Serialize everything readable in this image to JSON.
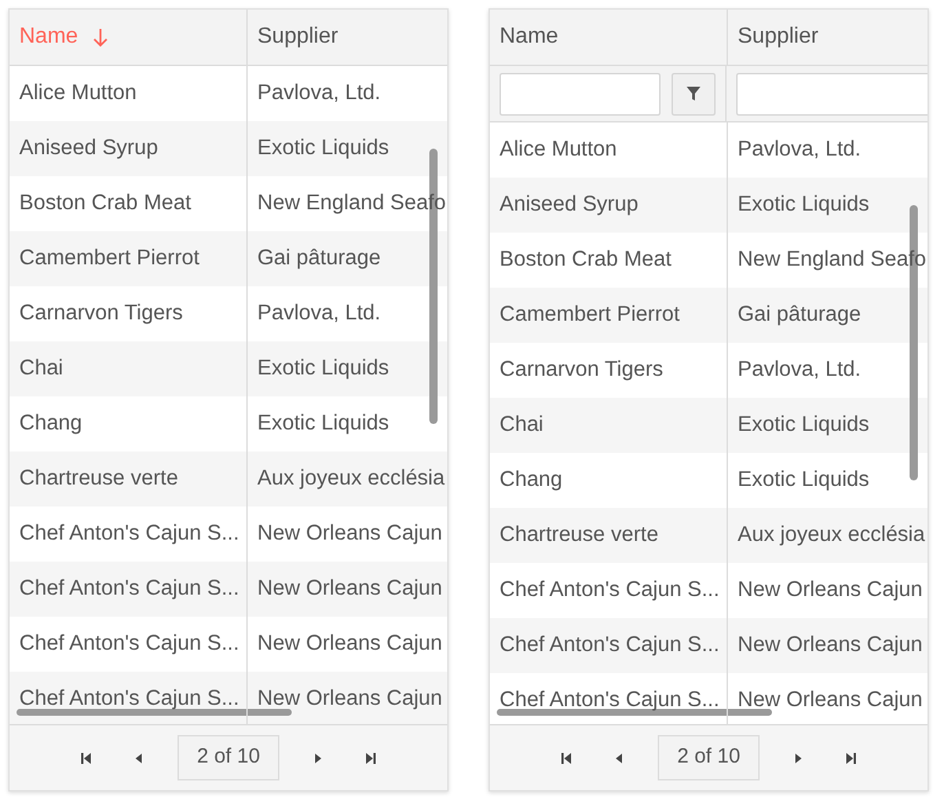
{
  "grids": [
    {
      "columns": [
        {
          "label": "Name",
          "sorted": true
        },
        {
          "label": "Supplier",
          "sorted": false
        }
      ],
      "show_filters": false,
      "rows": [
        [
          "Alice Mutton",
          "Pavlova, Ltd."
        ],
        [
          "Aniseed Syrup",
          "Exotic Liquids"
        ],
        [
          "Boston Crab Meat",
          "New England Seafo"
        ],
        [
          "Camembert Pierrot",
          "Gai pâturage"
        ],
        [
          "Carnarvon Tigers",
          "Pavlova, Ltd."
        ],
        [
          "Chai",
          "Exotic Liquids"
        ],
        [
          "Chang",
          "Exotic Liquids"
        ],
        [
          "Chartreuse verte",
          "Aux joyeux ecclésia"
        ],
        [
          "Chef Anton's Cajun S...",
          "New Orleans Cajun"
        ],
        [
          "Chef Anton's Cajun S...",
          "New Orleans Cajun"
        ],
        [
          "Chef Anton's Cajun S...",
          "New Orleans Cajun"
        ],
        [
          "Chef Anton's Cajun S...",
          "New Orleans Cajun"
        ]
      ],
      "pager": {
        "page": "2 of 10"
      }
    },
    {
      "columns": [
        {
          "label": "Name",
          "sorted": false
        },
        {
          "label": "Supplier",
          "sorted": false
        }
      ],
      "show_filters": true,
      "rows": [
        [
          "Alice Mutton",
          "Pavlova, Ltd."
        ],
        [
          "Aniseed Syrup",
          "Exotic Liquids"
        ],
        [
          "Boston Crab Meat",
          "New England Seafo"
        ],
        [
          "Camembert Pierrot",
          "Gai pâturage"
        ],
        [
          "Carnarvon Tigers",
          "Pavlova, Ltd."
        ],
        [
          "Chai",
          "Exotic Liquids"
        ],
        [
          "Chang",
          "Exotic Liquids"
        ],
        [
          "Chartreuse verte",
          "Aux joyeux ecclésia"
        ],
        [
          "Chef Anton's Cajun S...",
          "New Orleans Cajun"
        ],
        [
          "Chef Anton's Cajun S...",
          "New Orleans Cajun"
        ],
        [
          "Chef Anton's Cajun S...",
          "New Orleans Cajun"
        ]
      ],
      "pager": {
        "page": "2 of 10"
      }
    }
  ]
}
